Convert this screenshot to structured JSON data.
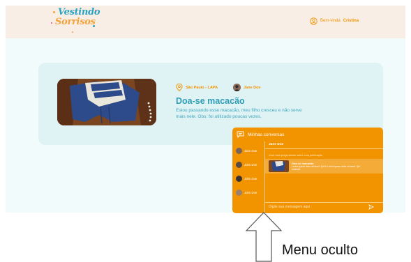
{
  "header": {
    "logo": {
      "line1": "Vestindo",
      "line2": "Sorrisos"
    },
    "greeting_prefix": "Bem-vinda",
    "user_name": "Cristina"
  },
  "product": {
    "location": "São Paulo - LAPA",
    "donor_name": "Jane Doe",
    "title": "Doa-se macacão",
    "description": "Estou passando esse macacão, meu filho cresceu e não serve mais nele. Obs: foi utilizado poucas vezes."
  },
  "chat": {
    "title": "Minhas conversas",
    "contacts": [
      {
        "name": "Jane Doe"
      },
      {
        "name": "John Doe"
      },
      {
        "name": "John Doe"
      },
      {
        "name": "John Doe"
      }
    ],
    "active_conversation": {
      "name": "Jane Doe",
      "note": "Você está perguntando sobre esta publicação",
      "item_title": "Doa-se macacão",
      "item_desc": "Lorem ipsum dolor sit amet. Qui in Lorem ipsum dolor sit amet. Qui molestis"
    },
    "input_placeholder": "Digite sua mensagem aqui"
  },
  "annotation": {
    "label": "Menu oculto"
  },
  "colors": {
    "accent": "#f29400",
    "brand_blue": "#2e9cb7",
    "header_bg": "#f8eee6",
    "card_bg": "#dff3f5"
  }
}
